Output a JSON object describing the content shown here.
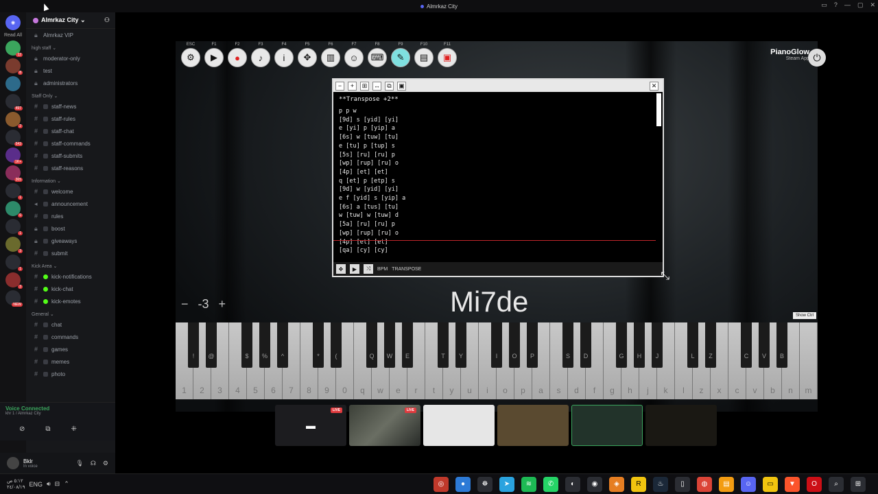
{
  "window": {
    "title": "Almrkaz City"
  },
  "servers": {
    "read_all": "Read All",
    "badges": [
      "12",
      "8",
      "497",
      "2",
      "543",
      "1K+",
      "365",
      "1",
      "6",
      "1",
      "3",
      "1",
      "3",
      "NEW"
    ]
  },
  "guild": {
    "name": "Almrkaz City ⌄"
  },
  "channels": {
    "top": [
      {
        "label": "Almrkaz VIP"
      }
    ],
    "high_staff": {
      "title": "high staff ⌄",
      "items": [
        "moderator-only",
        "test",
        "administrators"
      ]
    },
    "staff_only": {
      "title": "Staff Only ⌄",
      "items": [
        "staff-news",
        "staff-rules",
        "staff-chat",
        "staff-commands",
        "staff-submits",
        "staff-reasons"
      ]
    },
    "information": {
      "title": "Information ⌄",
      "items": [
        "welcome",
        "announcement",
        "rules",
        "boost",
        "giveaways",
        "submit"
      ]
    },
    "kick_area": {
      "title": "Kick Area ⌄",
      "items": [
        "kick-notifications",
        "kick-chat",
        "kick-emotes"
      ]
    },
    "general": {
      "title": "General ⌄",
      "items": [
        "chat",
        "commands",
        "games",
        "memes",
        "photo"
      ]
    }
  },
  "voice": {
    "status": "Voice Connected",
    "channel": "khr 1 / Almrkaz City"
  },
  "user": {
    "name": "Bklr",
    "status": "In voice"
  },
  "piano": {
    "toolbar_keys": [
      "ESC",
      "F1",
      "F2",
      "F3",
      "F4",
      "F5",
      "F6",
      "F7",
      "F8",
      "F9",
      "F10",
      "F11"
    ],
    "brand": "PianoGlow",
    "brand_sub": "Steam App",
    "transpose_value": "-3",
    "minus": "−",
    "plus": "+",
    "main_label": "Mi7de",
    "sheet_button": "Show Ctrl",
    "foot_left": "BPM",
    "foot_transpose": "TRANSPOSE",
    "white_keys": [
      "1",
      "2",
      "3",
      "4",
      "5",
      "6",
      "7",
      "8",
      "9",
      "0",
      "q",
      "w",
      "e",
      "r",
      "t",
      "y",
      "u",
      "i",
      "o",
      "p",
      "a",
      "s",
      "d",
      "f",
      "g",
      "h",
      "j",
      "k",
      "l",
      "z",
      "x",
      "c",
      "v",
      "b",
      "n",
      "m"
    ],
    "black_keys": [
      "!",
      "@",
      "$",
      "%",
      "^",
      "*",
      "(",
      "Q",
      "W",
      "E",
      "T",
      "Y",
      "I",
      "O",
      "P",
      "S",
      "D",
      "G",
      "H",
      "J",
      "L",
      "Z",
      "C",
      "V",
      "B"
    ]
  },
  "sheet": {
    "heading": "**Transpose +2**",
    "lines": [
      "p p w",
      "[9d] s [yid] [yi]",
      "e [yi] p [yip] a",
      "[6s] w [tuw] [tu]",
      "e [tu] p [tup] s",
      "[5s] [ru] [ru] p",
      "[wp] [rup] [ru] o",
      "[4p] [et] [et]",
      "q [et] p [etp] s",
      "[9d] w [yid] [yi]",
      "e f [yid] s [yip] a",
      "[6s] a [tus] [tu]",
      "w [tuw] w [tuw] d",
      "[5a] [ru] [ru] p",
      "[wp] [rup] [ru] o",
      "[4p] [et] [et]",
      "[qa] [cy] [cy]"
    ]
  },
  "streams": {
    "live_label": "LIVE"
  },
  "taskbar": {
    "lang": "ENG",
    "time": "٥:١٢ ص",
    "date": "٢٤/٠٨/١٩"
  }
}
